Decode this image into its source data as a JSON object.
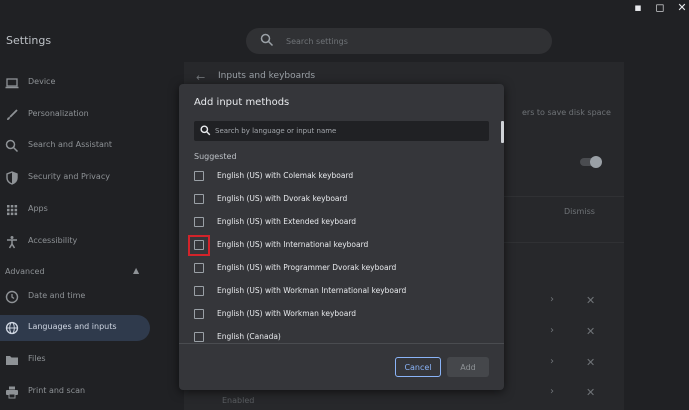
{
  "window": {
    "minimize_glyph": "▪",
    "maximize_glyph": "◻",
    "close_glyph": "✕"
  },
  "header": {
    "title": "Settings",
    "search_placeholder": "Search settings"
  },
  "sidebar": {
    "items": [
      {
        "label": "Device",
        "icon": "laptop-icon"
      },
      {
        "label": "Personalization",
        "icon": "brush-icon"
      },
      {
        "label": "Search and Assistant",
        "icon": "search-icon"
      },
      {
        "label": "Security and Privacy",
        "icon": "shield-icon"
      },
      {
        "label": "Apps",
        "icon": "apps-grid-icon"
      },
      {
        "label": "Accessibility",
        "icon": "accessibility-icon"
      }
    ],
    "advanced_label": "Advanced",
    "advanced_chevron": "▲",
    "advanced_items": [
      {
        "label": "Date and time",
        "icon": "clock-icon"
      },
      {
        "label": "Languages and inputs",
        "icon": "globe-icon",
        "active": true
      },
      {
        "label": "Files",
        "icon": "folder-icon"
      },
      {
        "label": "Print and scan",
        "icon": "printer-icon"
      }
    ]
  },
  "content": {
    "back_glyph": "←",
    "page_title": "Inputs and keyboards",
    "partial_text": "ers to save disk space",
    "dismiss_label": "Dismiss",
    "enabled_label": "Enabled",
    "chevron_glyph": "›",
    "remove_glyph": "✕"
  },
  "dialog": {
    "title": "Add input methods",
    "search_placeholder": "Search by language or input name",
    "section_label": "Suggested",
    "methods": [
      {
        "label": "English (US) with Colemak keyboard",
        "checked": false
      },
      {
        "label": "English (US) with Dvorak keyboard",
        "checked": false
      },
      {
        "label": "English (US) with Extended keyboard",
        "checked": false
      },
      {
        "label": "English (US) with International keyboard",
        "checked": false,
        "highlighted": true
      },
      {
        "label": "English (US) with Programmer Dvorak keyboard",
        "checked": false
      },
      {
        "label": "English (US) with Workman International keyboard",
        "checked": false
      },
      {
        "label": "English (US) with Workman keyboard",
        "checked": false
      },
      {
        "label": "English (Canada)",
        "checked": false
      }
    ],
    "cancel_label": "Cancel",
    "add_label": "Add",
    "highlight_color": "#d2232a",
    "accent_color": "#8ab4f8"
  }
}
